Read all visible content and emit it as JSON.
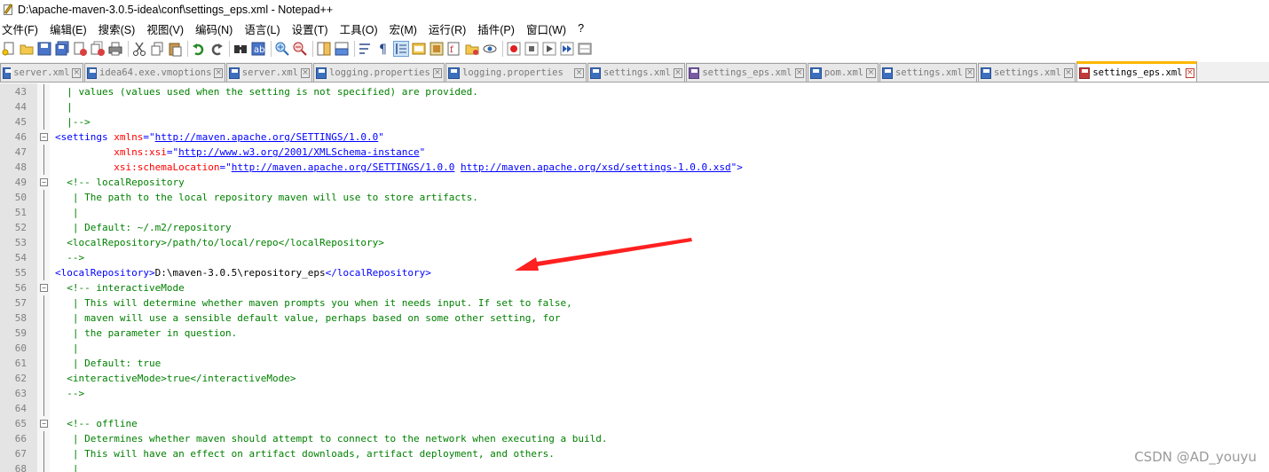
{
  "window": {
    "title": "D:\\apache-maven-3.0.5-idea\\conf\\settings_eps.xml - Notepad++"
  },
  "menu": [
    "文件(F)",
    "编辑(E)",
    "搜索(S)",
    "视图(V)",
    "编码(N)",
    "语言(L)",
    "设置(T)",
    "工具(O)",
    "宏(M)",
    "运行(R)",
    "插件(P)",
    "窗口(W)",
    "?"
  ],
  "toolbar_icons": [
    "new-file-icon",
    "open-file-icon",
    "save-icon",
    "save-all-icon",
    "close-icon",
    "close-all-icon",
    "print-icon",
    "cut-icon",
    "copy-icon",
    "paste-icon",
    "undo-icon",
    "redo-icon",
    "find-icon",
    "replace-icon",
    "zoom-in-icon",
    "zoom-out-icon",
    "sync-vertical-icon",
    "sync-horizontal-icon",
    "word-wrap-icon",
    "show-all-chars-icon",
    "indent-guide-icon",
    "user-lang-icon",
    "doc-map-icon",
    "function-list-icon",
    "folder-workspace-icon",
    "monitor-icon",
    "record-macro-icon",
    "stop-macro-icon",
    "play-macro-icon",
    "run-macro-multiple-icon",
    "save-macro-icon"
  ],
  "tabs": [
    {
      "label": "server.xml",
      "color": "blue",
      "active": false
    },
    {
      "label": "idea64.exe.vmoptions",
      "color": "blue",
      "active": false
    },
    {
      "label": "server.xml",
      "color": "blue",
      "active": false
    },
    {
      "label": "logging.properties",
      "color": "blue",
      "active": false
    },
    {
      "label": "logging.properties",
      "color": "blue",
      "active": false
    },
    {
      "label": "settings.xml",
      "color": "blue",
      "active": false
    },
    {
      "label": "settings_eps.xml",
      "color": "purple",
      "active": false
    },
    {
      "label": "pom.xml",
      "color": "blue",
      "active": false
    },
    {
      "label": "settings.xml",
      "color": "blue",
      "active": false
    },
    {
      "label": "settings.xml",
      "color": "blue",
      "active": false
    },
    {
      "label": "settings_eps.xml",
      "color": "red",
      "active": true
    }
  ],
  "tab_close_glyph": "×",
  "editor": {
    "lines": [
      {
        "n": "43",
        "segs": [
          [
            "c-comment",
            "  | values (values used when the setting is not specified) are provided."
          ]
        ]
      },
      {
        "n": "44",
        "segs": [
          [
            "c-comment",
            "  |"
          ]
        ]
      },
      {
        "n": "45",
        "segs": [
          [
            "c-comment",
            "  |-->"
          ]
        ]
      },
      {
        "n": "46",
        "segs": [
          [
            "c-tag",
            "<settings "
          ],
          [
            "c-attr",
            "xmlns"
          ],
          [
            "c-tag",
            "=\""
          ],
          [
            "c-link",
            "http://maven.apache.org/SETTINGS/1.0.0"
          ],
          [
            "c-tag",
            "\""
          ]
        ]
      },
      {
        "n": "47",
        "segs": [
          [
            "c-text",
            "          "
          ],
          [
            "c-attr",
            "xmlns:xsi"
          ],
          [
            "c-tag",
            "=\""
          ],
          [
            "c-link",
            "http://www.w3.org/2001/XMLSchema-instance"
          ],
          [
            "c-tag",
            "\""
          ]
        ]
      },
      {
        "n": "48",
        "segs": [
          [
            "c-text",
            "          "
          ],
          [
            "c-attr",
            "xsi:schemaLocation"
          ],
          [
            "c-tag",
            "=\""
          ],
          [
            "c-link",
            "http://maven.apache.org/SETTINGS/1.0.0"
          ],
          [
            "c-tag",
            " "
          ],
          [
            "c-link",
            "http://maven.apache.org/xsd/settings-1.0.0.xsd"
          ],
          [
            "c-tag",
            "\">"
          ]
        ]
      },
      {
        "n": "49",
        "segs": [
          [
            "c-comment",
            "  <!-- localRepository"
          ]
        ]
      },
      {
        "n": "50",
        "segs": [
          [
            "c-comment",
            "   | The path to the local repository maven will use to store artifacts."
          ]
        ]
      },
      {
        "n": "51",
        "segs": [
          [
            "c-comment",
            "   |"
          ]
        ]
      },
      {
        "n": "52",
        "segs": [
          [
            "c-comment",
            "   | Default: ~/.m2/repository"
          ]
        ]
      },
      {
        "n": "53",
        "segs": [
          [
            "c-comment",
            "  <localRepository>/path/to/local/repo</localRepository>"
          ]
        ]
      },
      {
        "n": "54",
        "segs": [
          [
            "c-comment",
            "  -->"
          ]
        ]
      },
      {
        "n": "55",
        "segs": [
          [
            "c-tag",
            "<localRepository>"
          ],
          [
            "c-text",
            "D:\\maven-3.0.5\\repository_eps"
          ],
          [
            "c-tag",
            "</localRepository>"
          ]
        ]
      },
      {
        "n": "56",
        "segs": [
          [
            "c-comment",
            "  <!-- interactiveMode"
          ]
        ]
      },
      {
        "n": "57",
        "segs": [
          [
            "c-comment",
            "   | This will determine whether maven prompts you when it needs input. If set to false,"
          ]
        ]
      },
      {
        "n": "58",
        "segs": [
          [
            "c-comment",
            "   | maven will use a sensible default value, perhaps based on some other setting, for"
          ]
        ]
      },
      {
        "n": "59",
        "segs": [
          [
            "c-comment",
            "   | the parameter in question."
          ]
        ]
      },
      {
        "n": "60",
        "segs": [
          [
            "c-comment",
            "   |"
          ]
        ]
      },
      {
        "n": "61",
        "segs": [
          [
            "c-comment",
            "   | Default: true"
          ]
        ]
      },
      {
        "n": "62",
        "segs": [
          [
            "c-comment",
            "  <interactiveMode>true</interactiveMode>"
          ]
        ]
      },
      {
        "n": "63",
        "segs": [
          [
            "c-comment",
            "  -->"
          ]
        ]
      },
      {
        "n": "64",
        "segs": [
          [
            "c-text",
            ""
          ]
        ]
      },
      {
        "n": "65",
        "segs": [
          [
            "c-comment",
            "  <!-- offline"
          ]
        ]
      },
      {
        "n": "66",
        "segs": [
          [
            "c-comment",
            "   | Determines whether maven should attempt to connect to the network when executing a build."
          ]
        ]
      },
      {
        "n": "67",
        "segs": [
          [
            "c-comment",
            "   | This will have an effect on artifact downloads, artifact deployment, and others."
          ]
        ]
      },
      {
        "n": "68",
        "segs": [
          [
            "c-comment",
            "   |"
          ]
        ]
      }
    ]
  },
  "colors": {
    "comment": "#008000",
    "tag": "#0000ff",
    "attribute": "#ff0000",
    "link": "#0000ff",
    "arrow": "#ff2020",
    "active_tab_accent": "#ffb800"
  },
  "watermark": "CSDN @AD_youyu"
}
